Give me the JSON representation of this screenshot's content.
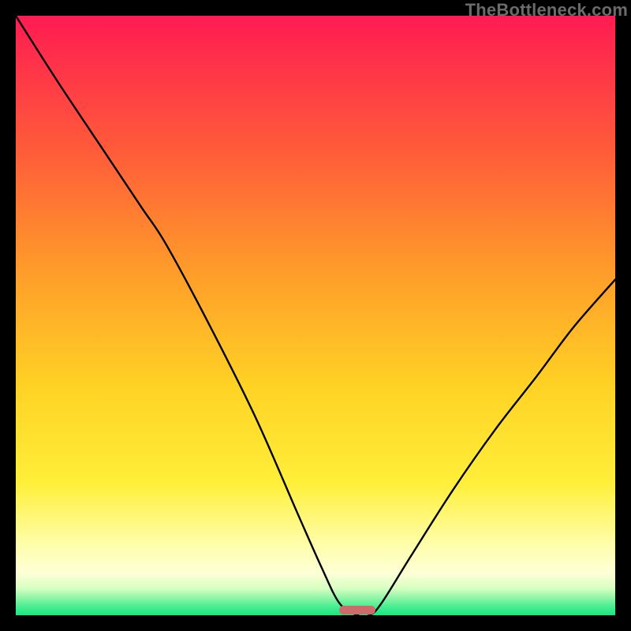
{
  "watermark": "TheBottleneck.com",
  "colors": {
    "top": "#ff1b52",
    "orange": "#ff8a2a",
    "yellow": "#ffe924",
    "pale_yellow": "#fffec0",
    "green": "#1be783",
    "marker": "#cf6a6a",
    "curve": "#000000"
  },
  "chart_data": {
    "type": "line",
    "title": "",
    "xlabel": "",
    "ylabel": "",
    "x_range": [
      0,
      100
    ],
    "y_range": [
      0,
      100
    ],
    "notes": "V-shaped bottleneck curve. Vertex at x≈57 where y≈0 (optimal). Left branch rises to y≈100 at x≈0; right branch rises to y≈56 at x≈100. Background vertical gradient red→yellow→green encodes the same magnitude.",
    "series": [
      {
        "name": "bottleneck",
        "points": [
          {
            "x": 0,
            "y": 100
          },
          {
            "x": 7,
            "y": 89
          },
          {
            "x": 15,
            "y": 77
          },
          {
            "x": 21,
            "y": 68
          },
          {
            "x": 25,
            "y": 62
          },
          {
            "x": 32,
            "y": 49
          },
          {
            "x": 40,
            "y": 33
          },
          {
            "x": 47,
            "y": 17
          },
          {
            "x": 51,
            "y": 8
          },
          {
            "x": 54,
            "y": 2
          },
          {
            "x": 57,
            "y": 0
          },
          {
            "x": 59,
            "y": 0
          },
          {
            "x": 61,
            "y": 2
          },
          {
            "x": 66,
            "y": 10
          },
          {
            "x": 73,
            "y": 21
          },
          {
            "x": 80,
            "y": 31
          },
          {
            "x": 87,
            "y": 40
          },
          {
            "x": 93,
            "y": 48
          },
          {
            "x": 100,
            "y": 56
          }
        ]
      }
    ],
    "marker": {
      "x_start": 54,
      "x_end": 60,
      "y": 0
    }
  }
}
